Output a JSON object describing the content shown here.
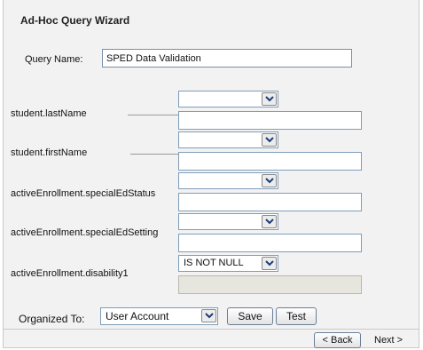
{
  "wizard": {
    "title": "Ad-Hoc Query Wizard",
    "query_name_label": "Query Name:",
    "query_name_value": "SPED Data Validation"
  },
  "fields": [
    {
      "label": "student.lastName",
      "operator": "",
      "value": ""
    },
    {
      "label": "student.firstName",
      "operator": "",
      "value": ""
    },
    {
      "label": "activeEnrollment.specialEdStatus",
      "operator": "",
      "value": ""
    },
    {
      "label": "activeEnrollment.specialEdSetting",
      "operator": "",
      "value": ""
    },
    {
      "label": "activeEnrollment.disability1",
      "operator": "IS NOT NULL",
      "value": ""
    }
  ],
  "organize": {
    "label": "Organized To:",
    "selected": "User Account"
  },
  "buttons": {
    "save": "Save",
    "test": "Test",
    "back": "< Back",
    "next": "Next >"
  },
  "icons": {
    "dropdown": "chevron-down-icon"
  }
}
